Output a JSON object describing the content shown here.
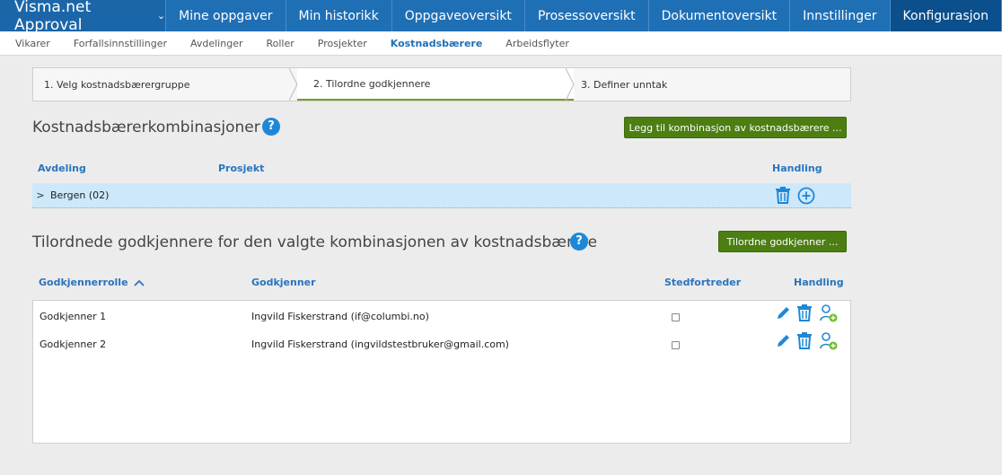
{
  "app": {
    "title": "Visma.net Approval",
    "dropdown_glyph": "⌄"
  },
  "nav": {
    "items": [
      {
        "label": "Mine oppgaver"
      },
      {
        "label": "Min historikk"
      },
      {
        "label": "Oppgaveoversikt"
      },
      {
        "label": "Prosessoversikt"
      },
      {
        "label": "Dokumentoversikt"
      },
      {
        "label": "Innstillinger"
      },
      {
        "label": "Konfigurasjon"
      }
    ],
    "active_index": 6
  },
  "subnav": {
    "items": [
      {
        "label": "Vikarer"
      },
      {
        "label": "Forfallsinnstillinger"
      },
      {
        "label": "Avdelinger"
      },
      {
        "label": "Roller"
      },
      {
        "label": "Prosjekter"
      },
      {
        "label": "Kostnadsbærere"
      },
      {
        "label": "Arbeidsflyter"
      }
    ],
    "active_index": 5
  },
  "wizard": {
    "steps": [
      {
        "label": "1. Velg kostnadsbærergruppe"
      },
      {
        "label": "2. Tilordne godkjennere"
      },
      {
        "label": "3. Definer unntak"
      }
    ],
    "active_index": 1
  },
  "combinations": {
    "title": "Kostnadsbærerkombinasjoner",
    "help_glyph": "?",
    "add_button": "Legg til kombinasjon av kostnadsbærere ...",
    "columns": {
      "department": "Avdeling",
      "project": "Prosjekt",
      "action": "Handling"
    },
    "rows": [
      {
        "expand_glyph": ">",
        "label": "Bergen (02)"
      }
    ]
  },
  "approvers": {
    "title": "Tilordnede godkjennere for den valgte kombinasjonen av kostnadsbærere",
    "help_glyph": "?",
    "assign_button": "Tilordne godkjenner ...",
    "columns": {
      "role": "Godkjennerrolle",
      "approver": "Godkjenner",
      "deputy": "Stedfortreder",
      "action": "Handling"
    },
    "sort": {
      "column": "role",
      "direction": "ascending"
    },
    "rows": [
      {
        "role": "Godkjenner 1",
        "approver": "Ingvild Fiskerstrand (if@columbi.no)",
        "deputy": false
      },
      {
        "role": "Godkjenner 2",
        "approver": "Ingvild Fiskerstrand (ingvildstestbruker@gmail.com)",
        "deputy": false
      }
    ]
  },
  "colors": {
    "nav_bg": "#1f6fb5",
    "nav_active": "#0b4f8c",
    "accent_blue": "#1e88d8",
    "green_button": "#4c7e12",
    "selected_row": "#cde8fa",
    "column_header": "#2a74bd"
  },
  "icons": [
    "chevron-down-icon",
    "help-icon",
    "trash-icon",
    "add-circle-icon",
    "pencil-icon",
    "add-user-icon",
    "sort-up-icon",
    "expand-arrow-icon"
  ]
}
